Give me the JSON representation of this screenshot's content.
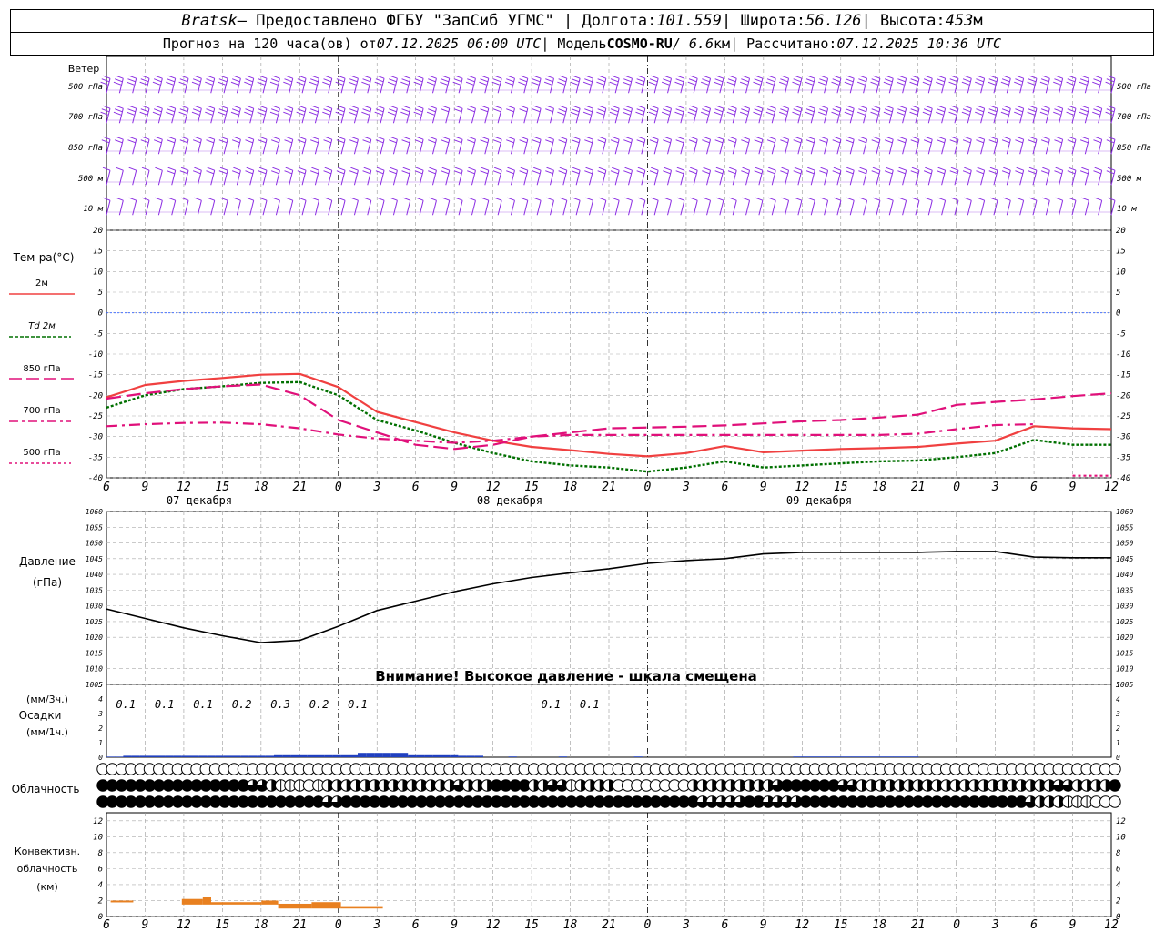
{
  "header": {
    "station": "Bratsk",
    "provider": " — Предоставлено ФГБУ \"ЗапСиб УГМС\" | Долгота: ",
    "lon": "101.559",
    "lat_label": " | Широта: ",
    "lat": "56.126",
    "alt_label": " | Высота: ",
    "alt": "453",
    "alt_unit": "м",
    "forecast_label": "Прогноз на 120 часа(ов) от ",
    "forecast_start": "07.12.2025 06:00 UTC",
    "model_label": "  | Модель ",
    "model": "COSMO-RU",
    "model_res": " / 6.6",
    "model_res_unit": "км",
    "calc_label": " | Рассчитано: ",
    "calc_time": "07.12.2025 10:36 UTC"
  },
  "labels": {
    "wind": "Ветер",
    "wind_levels": [
      "500 гПа",
      "700 гПа",
      "850 гПа",
      "500 м",
      "10  м"
    ],
    "temp_title": "Тем-ра(°C)",
    "temp_legend": [
      "2м",
      "Td  2м",
      "850 гПа",
      "700 гПа",
      "500 гПа"
    ],
    "pressure_title": "Давление",
    "pressure_unit": "(гПа)",
    "pressure_warning": "Внимание! Высокое давление - шкала смещена",
    "precip_unit_top": "(мм/3ч.)",
    "precip_title": "Осадки",
    "precip_unit_bottom": "(мм/1ч.)",
    "cloud_title": "Облачность",
    "conv_title_1": "Конвективн.",
    "conv_title_2": "облачность",
    "conv_unit": "(км)",
    "day_labels": [
      "07 декабря",
      "08 декабря",
      "09 декабря"
    ]
  },
  "colors": {
    "t2m": "#f04040",
    "td2m": "#007000",
    "t850": "#e0107a",
    "t700": "#e0107a",
    "t500": "#e0107a",
    "wind": "#8a2be2",
    "pressure": "#000000",
    "precip": "#2040c0",
    "convective": "#e88020"
  },
  "chart_data": {
    "type": "line",
    "x_hours_utc": [
      "6",
      "9",
      "12",
      "15",
      "18",
      "21",
      "0",
      "3",
      "6",
      "9",
      "12",
      "15",
      "18",
      "21",
      "0",
      "3",
      "6",
      "9",
      "12",
      "15",
      "18",
      "21",
      "0",
      "3",
      "6",
      "9",
      "12"
    ],
    "temperature": {
      "ylim": [
        -40,
        20
      ],
      "yticks": [
        20,
        15,
        10,
        5,
        0,
        -5,
        -10,
        -15,
        -20,
        -25,
        -30,
        -35,
        -40
      ],
      "series": [
        {
          "name": "2м",
          "values": [
            -20.5,
            -17.5,
            -16.5,
            -15.8,
            -15,
            -14.8,
            -18,
            -24,
            -26.5,
            -29,
            -31,
            -32.5,
            -33.3,
            -34.2,
            -34.8,
            -34,
            -32.3,
            -33.8,
            -33.4,
            -33,
            -32.8,
            -32.5,
            -31.7,
            -31,
            -27.5,
            -28,
            -28.2
          ]
        },
        {
          "name": "Td  2м",
          "values": [
            -23,
            -20,
            -18.5,
            -17.8,
            -17,
            -16.8,
            -20,
            -26,
            -28.5,
            -31.5,
            -34,
            -36,
            -37,
            -37.5,
            -38.5,
            -37.5,
            -36,
            -37.5,
            -37,
            -36.5,
            -36,
            -35.8,
            -35,
            -34,
            -30.8,
            -32,
            -32
          ]
        },
        {
          "name": "850 гПа",
          "values": [
            -20.8,
            -19.5,
            -18.5,
            -17.8,
            -17.4,
            -20,
            -26,
            -29,
            -32,
            -33,
            -32,
            -30,
            -29,
            -28,
            -27.8,
            -27.6,
            -27.3,
            -26.8,
            -26.3,
            -26,
            -25.4,
            -24.7,
            -22.3,
            -21.6,
            -21,
            -20.2,
            -19.5
          ]
        },
        {
          "name": "700 гПа",
          "values": [
            -27.5,
            -27,
            -26.7,
            -26.6,
            -27,
            -28,
            -29.5,
            -30.5,
            -31,
            -31.5,
            -31,
            -30,
            -29.6,
            -29.6,
            -29.6,
            -29.6,
            -29.6,
            -29.6,
            -29.6,
            -29.6,
            -29.6,
            -29.3,
            -28.2,
            -27.2,
            -27,
            null,
            null
          ]
        },
        {
          "name": "500 гПа",
          "values": [
            null,
            null,
            null,
            null,
            null,
            null,
            null,
            null,
            null,
            null,
            null,
            null,
            null,
            null,
            null,
            null,
            null,
            null,
            null,
            null,
            null,
            null,
            null,
            null,
            null,
            -39.5,
            -39.5
          ]
        }
      ]
    },
    "pressure": {
      "ylim": [
        1005,
        1060
      ],
      "yticks": [
        1060,
        1055,
        1050,
        1045,
        1040,
        1035,
        1030,
        1025,
        1020,
        1015,
        1010,
        1005
      ],
      "values": [
        1029,
        1026,
        1023,
        1020.5,
        1018.3,
        1019,
        1023.5,
        1028.5,
        1031.5,
        1034.5,
        1037,
        1039,
        1040.5,
        1041.8,
        1043.5,
        1044.4,
        1045,
        1046.5,
        1047,
        1047,
        1047,
        1047,
        1047.3,
        1047.3,
        1045.5,
        1045.3,
        1045.3
      ]
    },
    "precipitation": {
      "ylim": [
        0,
        5
      ],
      "yticks": [
        5,
        4,
        3,
        2,
        1,
        0
      ],
      "labels_3h": [
        {
          "hour_index": 0.5,
          "text": "0.1"
        },
        {
          "hour_index": 1.5,
          "text": "0.1"
        },
        {
          "hour_index": 2.5,
          "text": "0.1"
        },
        {
          "hour_index": 3.5,
          "text": "0.2"
        },
        {
          "hour_index": 4.5,
          "text": "0.3"
        },
        {
          "hour_index": 5.5,
          "text": "0.2"
        },
        {
          "hour_index": 6.5,
          "text": "0.1"
        },
        {
          "hour_index": 11.5,
          "text": "0.1"
        },
        {
          "hour_index": 12.5,
          "text": "0.1"
        }
      ],
      "hourly": [
        0.04,
        0.04,
        0.1,
        0.1,
        0.1,
        0.1,
        0.1,
        0.1,
        0.1,
        0.1,
        0.1,
        0.1,
        0.1,
        0.1,
        0.1,
        0.1,
        0.1,
        0.1,
        0.1,
        0.1,
        0.2,
        0.2,
        0.2,
        0.2,
        0.2,
        0.2,
        0.2,
        0.2,
        0.2,
        0.2,
        0.3,
        0.3,
        0.3,
        0.3,
        0.3,
        0.3,
        0.2,
        0.2,
        0.2,
        0.2,
        0.2,
        0.2,
        0.1,
        0.1,
        0.1,
        0,
        0,
        0,
        0.05,
        0,
        0,
        0,
        0,
        0,
        0.05,
        0,
        0,
        0,
        0,
        0,
        0,
        0,
        0,
        0.05,
        0,
        0,
        0,
        0,
        0,
        0,
        0,
        0,
        0,
        0,
        0,
        0,
        0,
        0,
        0,
        0,
        0,
        0,
        0.05,
        0.05,
        0.05,
        0.05,
        0.05,
        0.05,
        0.05,
        0.05,
        0.05,
        0.05,
        0.05,
        0.05,
        0.05,
        0.05,
        0.05,
        0,
        0,
        0,
        0,
        0,
        0,
        0,
        0,
        0,
        0,
        0,
        0,
        0,
        0,
        0,
        0,
        0,
        0,
        0,
        0,
        0,
        0,
        0,
        0,
        0,
        0,
        0,
        0,
        0,
        0,
        0,
        0
      ]
    },
    "clouds": {
      "rows": [
        "high",
        "middle",
        "low"
      ],
      "high": "0000000000000000000000000000000000000000000000000000000000000000000000000000000000000000000000000000000000000",
      "middle": "4444444444444444332111112222222222222232224444223312222000000002222222223444444332222222222222222222223322224",
      "low": "4444444444444444444444443344444444444444444444444444444444444444333334433334444444444444444444444443222111000"
    },
    "convective": {
      "ylim": [
        0,
        13
      ],
      "yticks": [
        12,
        10,
        8,
        6,
        4,
        2,
        0
      ],
      "segments": [
        {
          "from_h": 0.5,
          "to_h": 3.2,
          "bottom": 1.9,
          "top": 2.0
        },
        {
          "from_h": 9.0,
          "to_h": 11.5,
          "bottom": 1.5,
          "top": 2.2
        },
        {
          "from_h": 11.5,
          "to_h": 12.5,
          "bottom": 1.5,
          "top": 2.5
        },
        {
          "from_h": 12.5,
          "to_h": 18.5,
          "bottom": 1.5,
          "top": 1.8
        },
        {
          "from_h": 18.5,
          "to_h": 20.5,
          "bottom": 1.5,
          "top": 2.0
        },
        {
          "from_h": 20.5,
          "to_h": 24.5,
          "bottom": 1.0,
          "top": 1.6
        },
        {
          "from_h": 24.5,
          "to_h": 28.0,
          "bottom": 1.0,
          "top": 1.8
        },
        {
          "from_h": 28.0,
          "to_h": 33.0,
          "bottom": 1.0,
          "top": 1.3
        }
      ]
    },
    "wind": {
      "levels": [
        "500 гПа",
        "700 гПа",
        "850 гПа",
        "500 м",
        "10  м"
      ],
      "speed_class": [
        [
          3,
          3,
          3,
          3,
          3,
          3,
          3,
          3,
          3,
          3,
          3,
          3,
          3,
          3,
          3,
          3,
          3,
          3,
          3,
          3,
          3,
          3,
          3,
          3,
          3,
          3,
          3
        ],
        [
          3,
          3,
          3,
          3,
          3,
          3,
          3,
          3,
          3,
          2,
          2,
          2,
          3,
          3,
          3,
          3,
          3,
          3,
          3,
          3,
          3,
          3,
          3,
          3,
          3,
          3,
          3
        ],
        [
          2,
          2,
          2,
          2,
          2,
          2,
          2,
          2,
          2,
          2,
          2,
          2,
          2,
          2,
          2,
          2,
          2,
          2,
          2,
          2,
          2,
          2,
          2,
          2,
          2,
          2,
          2
        ],
        [
          1,
          1,
          2,
          2,
          2,
          2,
          2,
          2,
          2,
          2,
          2,
          2,
          2,
          2,
          2,
          2,
          2,
          2,
          2,
          2,
          2,
          2,
          2,
          2,
          2,
          2,
          2
        ],
        [
          1,
          1,
          1,
          1,
          1,
          1,
          1,
          1,
          1,
          1,
          1,
          1,
          1,
          1,
          1,
          1,
          1,
          1,
          1,
          1,
          1,
          1,
          1,
          1,
          1,
          1,
          1
        ]
      ]
    }
  }
}
